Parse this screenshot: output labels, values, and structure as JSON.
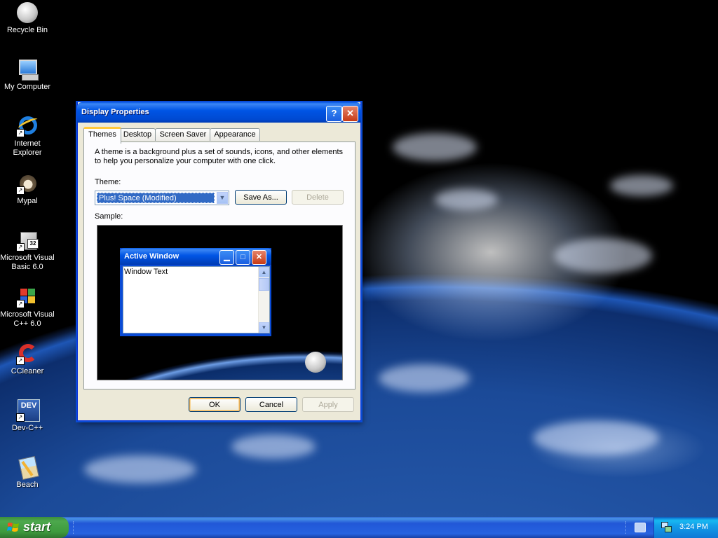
{
  "desktop": {
    "icons": [
      {
        "label": "Recycle Bin",
        "icon": "recycle-bin-icon"
      },
      {
        "label": "My Computer",
        "icon": "my-computer-icon"
      },
      {
        "label": "Internet Explorer",
        "icon": "internet-explorer-icon"
      },
      {
        "label": "Mypal",
        "icon": "mypal-icon"
      },
      {
        "label": "Microsoft Visual Basic 6.0",
        "icon": "visual-basic-icon"
      },
      {
        "label": "Microsoft Visual C++ 6.0",
        "icon": "visual-cpp-icon"
      },
      {
        "label": "CCleaner",
        "icon": "ccleaner-icon"
      },
      {
        "label": "Dev-C++",
        "icon": "dev-cpp-icon"
      },
      {
        "label": "Beach",
        "icon": "beach-picture-icon"
      }
    ]
  },
  "dialog": {
    "title": "Display Properties",
    "help_label": "?",
    "close_label": "✕",
    "tabs": [
      "Themes",
      "Desktop",
      "Screen Saver",
      "Appearance"
    ],
    "active_tab": "Themes",
    "description": "A theme is a background plus a set of sounds, icons, and other elements to help you personalize your computer with one click.",
    "theme_label": "Theme:",
    "theme_value": "Plus! Space (Modified)",
    "save_as_label": "Save As...",
    "delete_label": "Delete",
    "sample_label": "Sample:",
    "sample": {
      "window_title": "Active Window",
      "window_text": "Window Text"
    },
    "ok_label": "OK",
    "cancel_label": "Cancel",
    "apply_label": "Apply"
  },
  "taskbar": {
    "start_label": "start",
    "clock": "3:24 PM"
  },
  "colors": {
    "title_bar": "#0055e5",
    "dialog_face": "#ece9d8",
    "selection": "#316ac5",
    "start_button": "#3e9b3e"
  }
}
